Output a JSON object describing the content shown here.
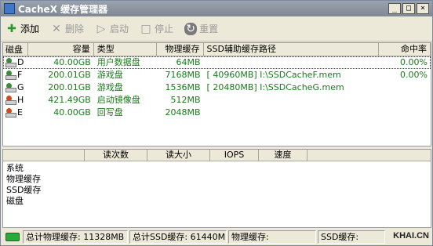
{
  "window": {
    "title": "CacheX 缓存管理器",
    "btn_minimize": "_",
    "btn_maximize": "□",
    "btn_close": "×"
  },
  "toolbar": {
    "add": "添加",
    "delete": "删除",
    "start": "启动",
    "stop": "停止",
    "reset": "重置"
  },
  "table": {
    "headers": {
      "disk": "磁盘",
      "capacity": "容量",
      "type": "类型",
      "phys_cache": "物理缓存",
      "ssd_path": "SSD辅助缓存路径",
      "hit_rate": "命中率"
    },
    "rows": [
      {
        "drive": "D",
        "capacity": "40.00GB",
        "type": "用户数据盘",
        "phys": "64MB",
        "ssd": "",
        "hit": "0.00%",
        "icon_color": "#3a8a3a"
      },
      {
        "drive": "F",
        "capacity": "200.01GB",
        "type": "游戏盘",
        "phys": "7168MB",
        "ssd": "[ 40960MB] I:\\SSDCacheF.mem",
        "hit": "0.00%",
        "icon_color": "#3a8a3a"
      },
      {
        "drive": "G",
        "capacity": "200.01GB",
        "type": "游戏盘",
        "phys": "1536MB",
        "ssd": "[ 20480MB] I:\\SSDCacheG.mem",
        "hit": "",
        "icon_color": "#3a8a3a"
      },
      {
        "drive": "H",
        "capacity": "421.49GB",
        "type": "启动镜像盘",
        "phys": "512MB",
        "ssd": "",
        "hit": "",
        "icon_color": "#d04a1a"
      },
      {
        "drive": "E",
        "capacity": "40.00GB",
        "type": "回写盘",
        "phys": "2048MB",
        "ssd": "",
        "hit": "",
        "icon_color": "#d04a1a"
      }
    ]
  },
  "stats": {
    "headers": {
      "blank": "",
      "reads": "读次数",
      "read_size": "读大小",
      "iops": "IOPS",
      "speed": "速度"
    },
    "rows": [
      "系统",
      "物理缓存",
      "SSD缓存",
      "磁盘"
    ]
  },
  "statusbar": {
    "total_phys": "总计物理缓存: 11328MB",
    "total_ssd": "总计SSD缓存: 61440MB",
    "phys_cache": "物理缓存:",
    "ssd_cache": "SSD缓存:",
    "watermark": "KHAI.CN"
  }
}
